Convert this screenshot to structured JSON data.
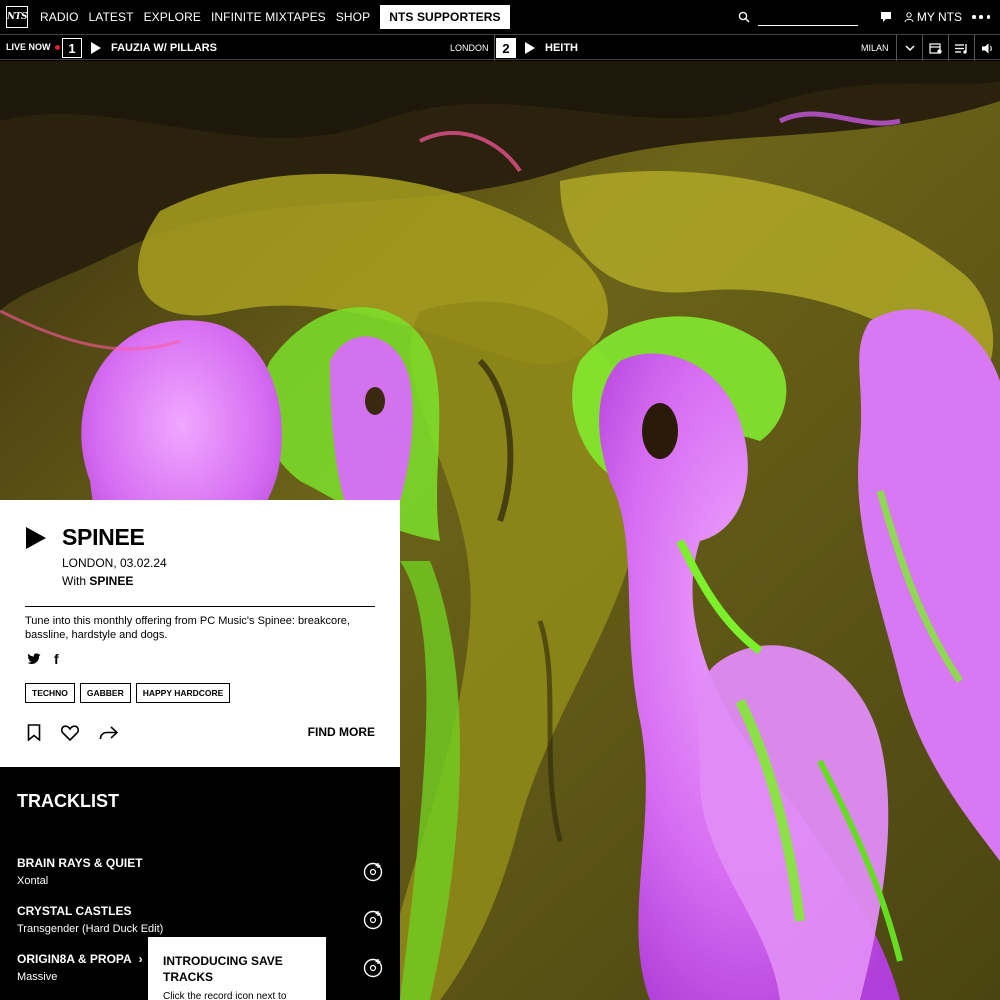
{
  "nav": {
    "logo_text": "NTS",
    "links": [
      "RADIO",
      "LATEST",
      "EXPLORE",
      "INFINITE MIXTAPES",
      "SHOP"
    ],
    "supporters": "NTS SUPPORTERS",
    "my_nts": "MY NTS",
    "search_value": ""
  },
  "live": {
    "label": "LIVE NOW",
    "channels": [
      {
        "number": "1",
        "title": "FAUZIA W/ PILLARS",
        "location": "LONDON"
      },
      {
        "number": "2",
        "title": "HEITH",
        "location": "MILAN"
      }
    ]
  },
  "show": {
    "title": "SPINEE",
    "location_date": "LONDON, 03.02.24",
    "with_prefix": "With",
    "with_name": "SPINEE",
    "description": "Tune into this monthly offering from PC Music's Spinee: breakcore, bassline, hardstyle and dogs.",
    "facebook_glyph": "f",
    "tags": [
      "TECHNO",
      "GABBER",
      "HAPPY HARDCORE"
    ],
    "find_more": "FIND MORE"
  },
  "tracklist": {
    "title": "TRACKLIST",
    "tracks": [
      {
        "title": "BRAIN RAYS & QUIET",
        "artist": "Xontal"
      },
      {
        "title": "CRYSTAL CASTLES",
        "artist": "Transgender (Hard Duck Edit)"
      },
      {
        "title": "ORIGIN8A & PROPA",
        "artist": "Massive",
        "chevron": "›"
      }
    ]
  },
  "popup": {
    "title": "INTRODUCING SAVE TRACKS",
    "body": "Click the record icon next to"
  },
  "colors": {
    "accent_live": "#e0202c",
    "art_yellow": "#b8b02a",
    "art_magenta": "#d879f0",
    "art_green": "#7cf02a"
  }
}
